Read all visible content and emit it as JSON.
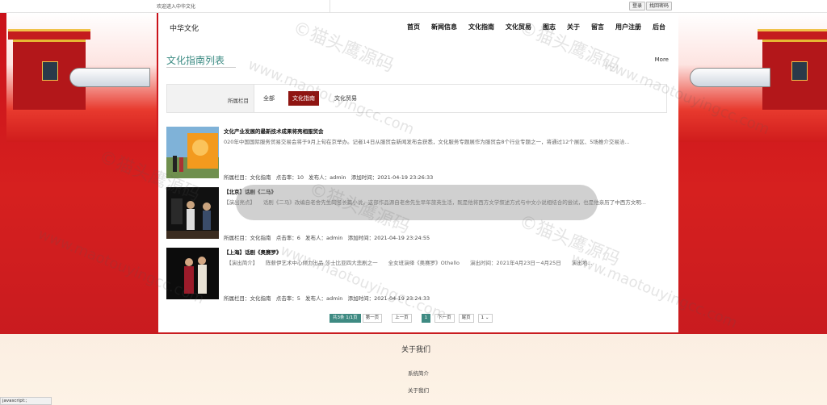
{
  "topbar": {
    "welcome": "欢迎进入中华文化",
    "login": "登录",
    "retrieve_password": "找回密码"
  },
  "header": {
    "logo": "中华文化",
    "nav": [
      "首页",
      "新闻信息",
      "文化指南",
      "文化贸易",
      "图志",
      "关于",
      "留言",
      "用户注册",
      "后台"
    ]
  },
  "main": {
    "page_title": "文化指南列表",
    "more": "More",
    "filter": {
      "label": "所属栏目",
      "options": [
        "全部",
        "文化指南",
        "文化贸易"
      ],
      "active": "文化指南"
    },
    "articles": [
      {
        "title": "文化产业发展的最新技术成果将亮相服贸会",
        "summary": "020年中国国际服务贸易交易会将于9月上旬在京举办。记者14日从服贸会新闻发布会获悉，文化服务专题展作为服贸会8个行业专题之一，将通过12个展区、5场推介交易洽...",
        "meta": "所属栏目：文化指南   点击率：10   发布人：admin   添加时间：2021-04-19 23:26:33"
      },
      {
        "title": "【北京】话剧《二马》",
        "summary": "【演出亮点】　　话剧《二马》改编自老舍先生同名长篇小说，这部作品源自老舍先生早年旅英生活，既是他将西方文学叙述方式与中文小说相结合的尝试，也是他亲历了中西方文明...",
        "meta": "所属栏目：文化指南   点击率：6   发布人：admin   添加时间：2021-04-19 23:24:55"
      },
      {
        "title": "【上海】话剧《奥赛罗》",
        "summary": "　【演出简介】　　陈薪伊艺术中心倾力出品 莎士比亚四大悲剧之一　　全女班演绎《奥赛罗》Othello　　演出时间：2021年4月23日－4月25日　　演出地...",
        "meta": "所属栏目：文化指南   点击率：5   发布人：admin   添加时间：2021-04-19 23:24:33"
      }
    ],
    "pagination": {
      "info": "共3条 1/1页",
      "first": "第一页",
      "prev": "上一页",
      "current": "1",
      "next": "下一页",
      "last": "尾页",
      "select": "1"
    }
  },
  "footer": {
    "title": "关于我们",
    "link1": "系统简介",
    "link2": "关于我们"
  },
  "status_bar": "javascript:;",
  "watermark": {
    "cn": "©猫头鹰源码",
    "url": "www.maotouyingcc.com"
  },
  "colors": {
    "accent": "#3e8a82",
    "active_filter": "#8f1512",
    "brand_red": "#d6201f"
  }
}
